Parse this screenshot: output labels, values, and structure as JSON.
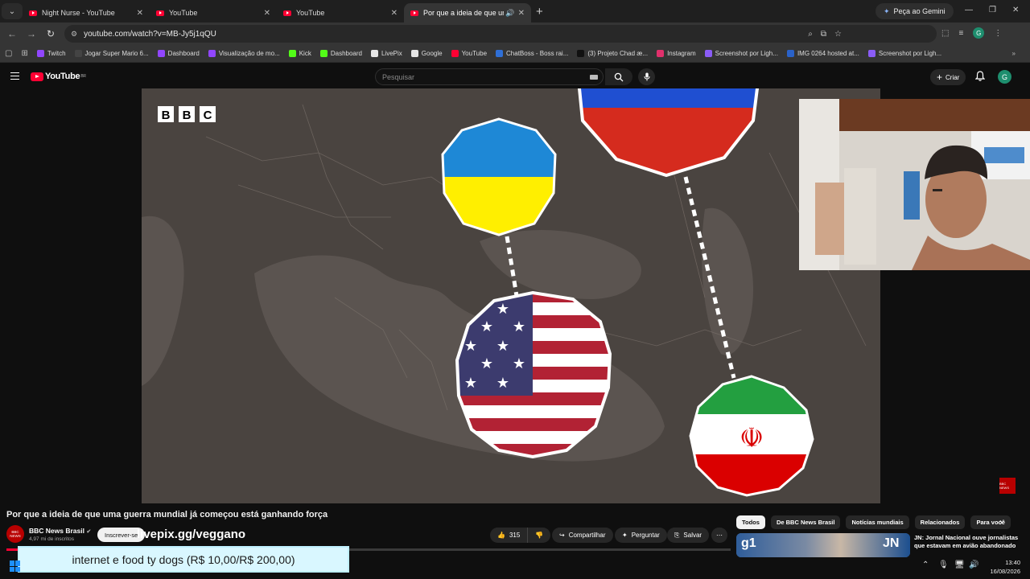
{
  "browser": {
    "tabs": [
      {
        "label": "Night Nurse - YouTube",
        "active": false
      },
      {
        "label": "YouTube",
        "active": false
      },
      {
        "label": "YouTube",
        "active": false
      },
      {
        "label": "Por que a ideia de que uma",
        "active": true
      }
    ],
    "gemini_label": "Peça ao Gemini",
    "url": "youtube.com/watch?v=MB-Jy5j1qQU",
    "profile_initial": "G",
    "bookmarks": [
      {
        "label": "Twitch",
        "color": "#9146ff"
      },
      {
        "label": "Jogar Super Mario 6...",
        "color": "#444444"
      },
      {
        "label": "Dashboard",
        "color": "#9146ff"
      },
      {
        "label": "Visualização de mo...",
        "color": "#9146ff"
      },
      {
        "label": "Kick",
        "color": "#53fc18"
      },
      {
        "label": "Dashboard",
        "color": "#53fc18"
      },
      {
        "label": "LivePix",
        "color": "#e6e6e6"
      },
      {
        "label": "Google",
        "color": "#e6e6e6"
      },
      {
        "label": "YouTube",
        "color": "#ff0033"
      },
      {
        "label": "ChatBoss - Boss rai...",
        "color": "#2f6fd6"
      },
      {
        "label": "(3) Projeto Chad æ...",
        "color": "#111111"
      },
      {
        "label": "Instagram",
        "color": "#e1306c"
      },
      {
        "label": "Screenshot por Ligh...",
        "color": "#8a5cf6"
      },
      {
        "label": "IMG 0264 hosted at...",
        "color": "#2a62c9"
      },
      {
        "label": "Screenshot por Ligh...",
        "color": "#8a5cf6"
      }
    ]
  },
  "youtube": {
    "logo_text": "YouTube",
    "logo_region": "BR",
    "search_placeholder": "Pesquisar",
    "create_label": "Criar",
    "avatar_initial": "G"
  },
  "video": {
    "bbc_letters": [
      "B",
      "B",
      "C"
    ],
    "title": "Por que a ideia de que uma guerra mundial já começou está ganhando força",
    "channel_name": "BBC News Brasil",
    "channel_logo": "BBC NEWS",
    "subscribers": "4,97 mi de inscritos",
    "subscribe_label": "Inscrever-se",
    "overlay_link": "livepix.gg/veggano",
    "likes": "315",
    "share_label": "Compartilhar",
    "ask_label": "Perguntar",
    "save_label": "Salvar",
    "progress": 0.16
  },
  "sidebar": {
    "chips": [
      "Todos",
      "De BBC News Brasil",
      "Notícias mundiais",
      "Relacionados",
      "Para você"
    ],
    "rec_title": "JN: Jornal Nacional ouve jornalistas que estavam em avião abandonado",
    "rec_badge": "g1",
    "rec_badge2": "JN"
  },
  "stream_overlay": {
    "donation_text": "internet e food ty dogs (R$ 10,00/R$ 200,00)"
  },
  "taskbar": {
    "time": "13:40",
    "date": "16/08/2026"
  },
  "colors": {
    "accent": "#ff0033",
    "usa_red": "#b22234",
    "usa_blue": "#3c3b6e",
    "ukraine_blue": "#1e88d6",
    "ukraine_yellow": "#ffef00",
    "iran_green": "#239f40",
    "iran_red": "#da0000",
    "russia_red": "#d52b1e"
  }
}
